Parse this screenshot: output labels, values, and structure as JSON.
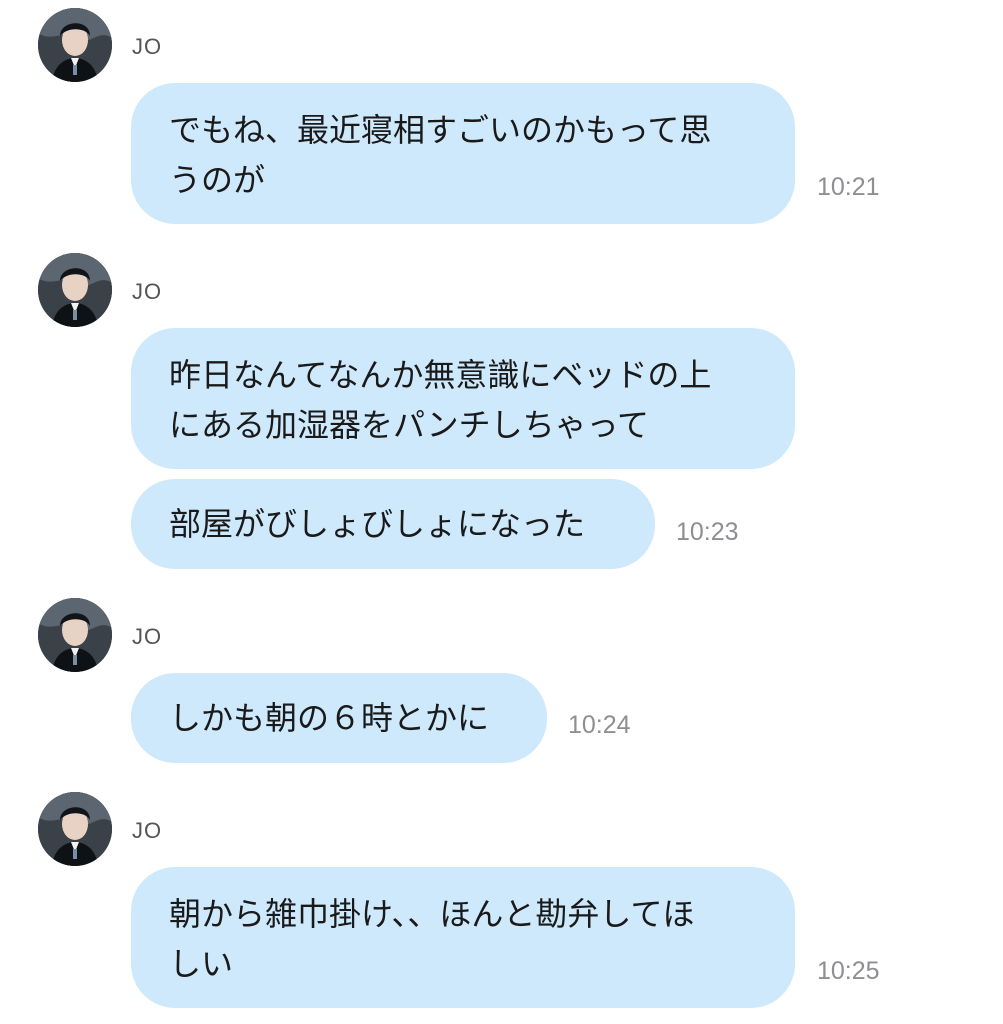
{
  "messages": [
    {
      "sender": "JO",
      "bubbles": [
        "でもね、最近寝相すごいのかもって思\nうのが"
      ],
      "time": "10:21"
    },
    {
      "sender": "JO",
      "bubbles": [
        "昨日なんてなんか無意識にベッドの上\nにある加湿器をパンチしちゃって",
        "部屋がびしょびしょになった"
      ],
      "time": "10:23"
    },
    {
      "sender": "JO",
      "bubbles": [
        "しかも朝の６時とかに"
      ],
      "time": "10:24"
    },
    {
      "sender": "JO",
      "bubbles": [
        "朝から雑巾掛け、、ほんと勘弁してほ\nしい"
      ],
      "time": "10:25"
    }
  ],
  "colors": {
    "bubble": "#cfe9fc",
    "text": "#1a1a1a",
    "timestamp": "#8e8e93",
    "sender": "#555555"
  },
  "icons": {
    "avatar": "user-avatar-photo"
  }
}
